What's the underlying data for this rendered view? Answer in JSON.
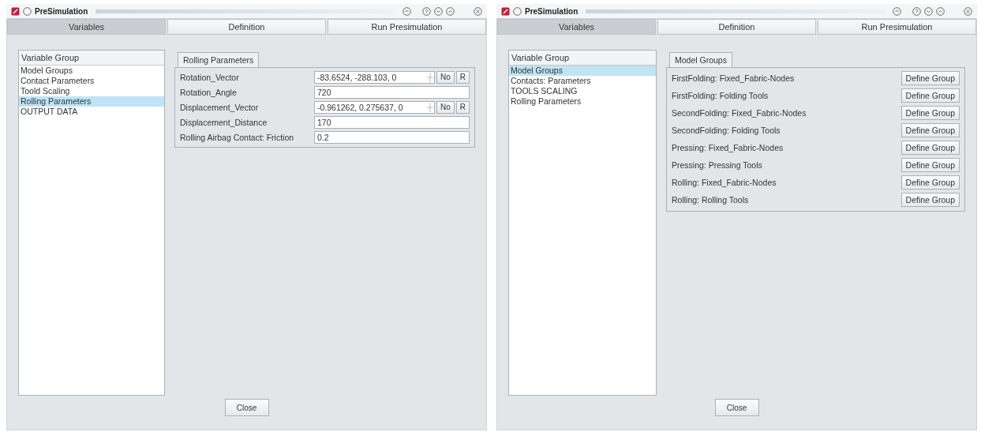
{
  "windows": [
    {
      "title": "PreSimulation",
      "tabs": [
        {
          "label": "Variables",
          "selected": true
        },
        {
          "label": "Definition",
          "selected": false
        },
        {
          "label": "Run Presimulation",
          "selected": false
        }
      ],
      "group_list": {
        "header": "Variable Group",
        "items": [
          {
            "label": "Model Groups",
            "selected": false
          },
          {
            "label": "Contact Parameters",
            "selected": false
          },
          {
            "label": "Toold Scaling",
            "selected": false
          },
          {
            "label": "Rolling Parameters",
            "selected": true
          },
          {
            "label": "OUTPUT DATA",
            "selected": false
          }
        ]
      },
      "panel": {
        "title": "Rolling Parameters",
        "rows": [
          {
            "kind": "vector",
            "label": "Rotation_Vector",
            "value": "-83.6524, -288.103, 0",
            "button_1": "No",
            "button_2": "R"
          },
          {
            "kind": "text",
            "label": "Rotation_Angle",
            "value": "720"
          },
          {
            "kind": "vector",
            "label": "Displacement_Vector",
            "value": "-0.961262, 0.275637, 0",
            "button_1": "No",
            "button_2": "R"
          },
          {
            "kind": "text",
            "label": "Displacement_Distance",
            "value": "170"
          },
          {
            "kind": "text",
            "label": "Rolling Airbag Contact: Friction",
            "value": "0.2"
          }
        ]
      },
      "close_button": "Close"
    },
    {
      "title": "PreSimulation",
      "tabs": [
        {
          "label": "Variables",
          "selected": true
        },
        {
          "label": "Definition",
          "selected": false
        },
        {
          "label": "Run Presimulation",
          "selected": false
        }
      ],
      "group_list": {
        "header": "Variable Group",
        "items": [
          {
            "label": "Model Groups",
            "selected": true
          },
          {
            "label": "Contacts: Parameters",
            "selected": false
          },
          {
            "label": "TOOLS SCALING",
            "selected": false
          },
          {
            "label": "Rolling Parameters",
            "selected": false
          }
        ]
      },
      "panel": {
        "title": "Model Groups",
        "rows": [
          {
            "kind": "group",
            "label": "FirstFolding: Fixed_Fabric-Nodes",
            "button": "Define Group"
          },
          {
            "kind": "group",
            "label": "FirstFolding: Folding Tools",
            "button": "Define Group"
          },
          {
            "kind": "group",
            "label": "SecondFolding: Fixed_Fabric-Nodes",
            "button": "Define Group"
          },
          {
            "kind": "group",
            "label": "SecondFolding: Folding Tools",
            "button": "Define Group"
          },
          {
            "kind": "group",
            "label": "Pressing: Fixed_Fabric-Nodes",
            "button": "Define Group"
          },
          {
            "kind": "group",
            "label": "Pressing: Pressing Tools",
            "button": "Define Group"
          },
          {
            "kind": "group",
            "label": "Rolling: Fixed_Fabric-Nodes",
            "button": "Define Group"
          },
          {
            "kind": "group",
            "label": "Rolling: Rolling Tools",
            "button": "Define Group"
          }
        ]
      },
      "close_button": "Close"
    }
  ]
}
